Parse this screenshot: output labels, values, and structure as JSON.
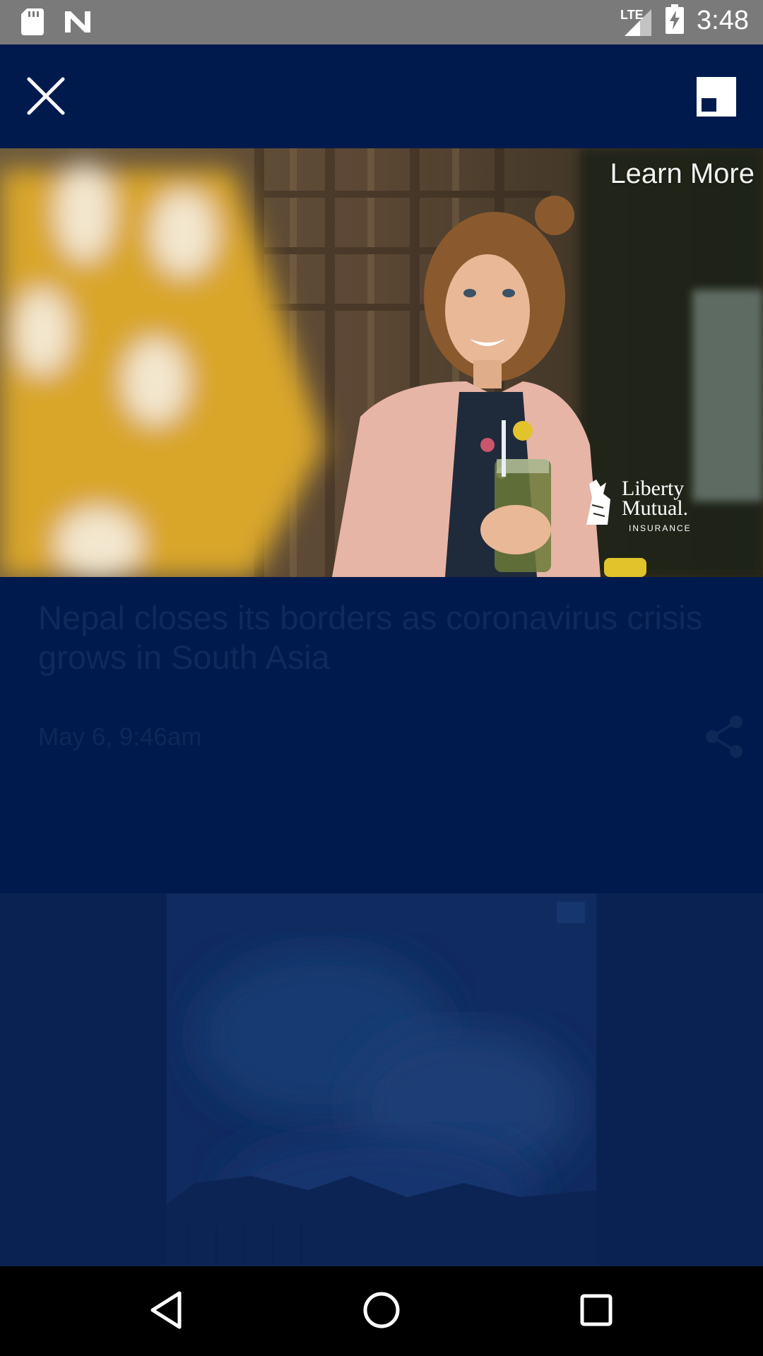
{
  "status_bar": {
    "time": "3:48",
    "network_label": "LTE",
    "icons": [
      "sd-card-icon",
      "n-logo-icon",
      "signal-icon",
      "battery-charging-icon"
    ]
  },
  "header": {
    "close_icon": "close-icon",
    "pip_icon": "picture-in-picture-icon"
  },
  "video": {
    "learn_more": "Learn More",
    "ad_brand_line1": "Liberty",
    "ad_brand_line2": "Mutual.",
    "ad_brand_line3": "INSURANCE"
  },
  "article": {
    "headline": "Nepal closes its borders as coronavirus crisis grows in South Asia",
    "timestamp": "May 6, 9:46am",
    "share_icon": "share-icon"
  },
  "nav_bar": {
    "icons": [
      "back-icon",
      "home-icon",
      "recents-icon"
    ]
  },
  "colors": {
    "status_bar": "#7a7a7a",
    "background": "#001a4d",
    "dimmed_text": "#102a5c",
    "nav_bar": "#000000"
  }
}
